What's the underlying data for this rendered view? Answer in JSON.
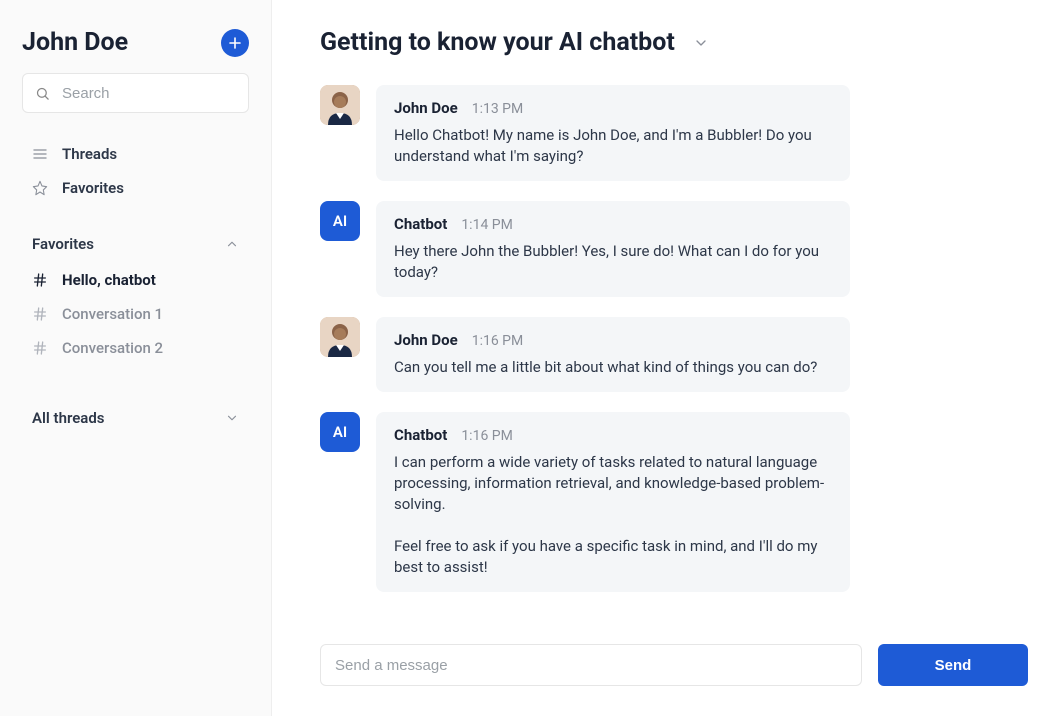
{
  "sidebar": {
    "user_name": "John Doe",
    "search_placeholder": "Search",
    "nav": {
      "threads_label": "Threads",
      "favorites_label": "Favorites"
    },
    "sections": {
      "favorites_header": "Favorites",
      "all_threads_header": "All threads"
    },
    "favorites": [
      {
        "label": "Hello, chatbot",
        "active": true
      },
      {
        "label": "Conversation 1",
        "active": false
      },
      {
        "label": "Conversation 2",
        "active": false
      }
    ]
  },
  "chat": {
    "title": "Getting to know your AI chatbot",
    "ai_avatar_label": "AI",
    "messages": [
      {
        "sender": "John Doe",
        "time": "1:13 PM",
        "body": "Hello Chatbot! My name is John Doe, and I'm a Bubbler! Do you understand what I'm saying?",
        "role": "user"
      },
      {
        "sender": "Chatbot",
        "time": "1:14 PM",
        "body": "Hey there John the Bubbler! Yes, I sure do! What can I do for you today?",
        "role": "ai"
      },
      {
        "sender": "John Doe",
        "time": "1:16 PM",
        "body": "Can you tell me a little bit about what kind of things you can do?",
        "role": "user"
      },
      {
        "sender": "Chatbot",
        "time": "1:16 PM",
        "body": "I can perform a wide variety of tasks related to natural language processing, information retrieval, and knowledge-based problem-solving.\n\nFeel free to ask if you have a specific task in mind, and I'll do my best to assist!",
        "role": "ai"
      }
    ]
  },
  "composer": {
    "placeholder": "Send a message",
    "send_label": "Send"
  }
}
